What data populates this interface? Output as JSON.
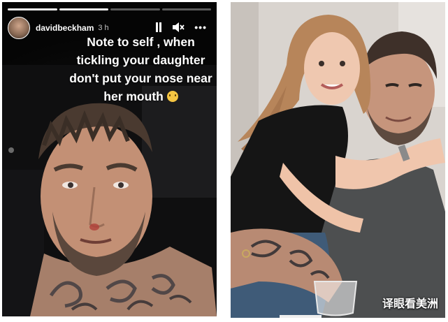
{
  "story": {
    "username": "davidbeckham",
    "time_ago": "3 h",
    "caption_lines": [
      "Note to self , when",
      "tickling your daughter",
      "don't put your nose near",
      "her mouth"
    ],
    "icons": {
      "avatar": "avatar",
      "pause": "pause-icon",
      "mute": "speaker-muted-icon",
      "more": "more-options-icon",
      "emoji": "grinning-emoji-icon"
    },
    "progress_segments": 4,
    "progress_filled": 2
  },
  "photo": {
    "watermark": "译眼看美洲"
  },
  "colors": {
    "story_bg": "#0b0b0b",
    "text": "#ffffff",
    "emoji": "#f5c542",
    "photo_bg": "#d7d3cf"
  }
}
